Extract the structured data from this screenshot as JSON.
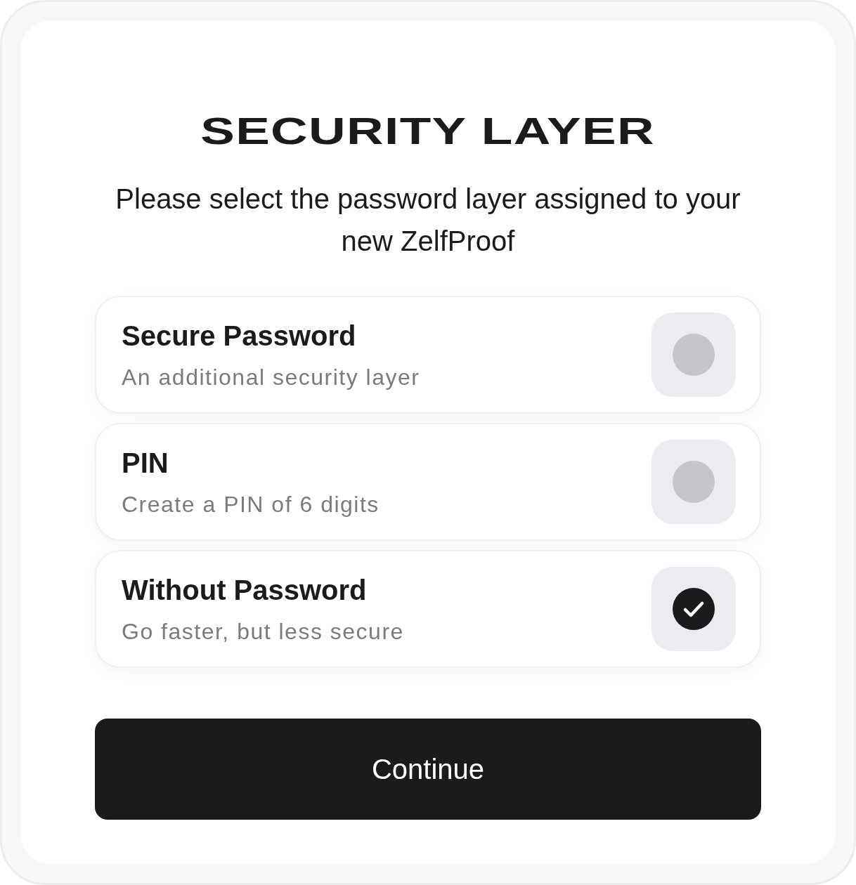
{
  "title": "SECURITY LAYER",
  "subtitle": "Please select the password layer assigned to your new ZelfProof",
  "options": [
    {
      "label": "Secure Password",
      "description": "An additional security layer",
      "selected": false
    },
    {
      "label": "PIN",
      "description": "Create a PIN of 6 digits",
      "selected": false
    },
    {
      "label": "Without Password",
      "description": "Go faster, but less secure",
      "selected": true
    }
  ],
  "button": "Continue"
}
